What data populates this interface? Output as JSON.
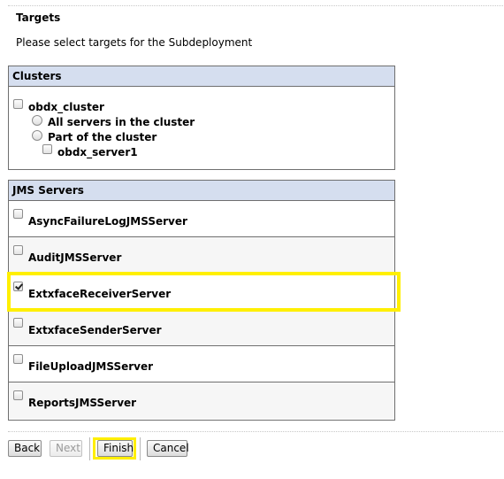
{
  "page": {
    "title": "Targets",
    "subtitle": "Please select targets for the Subdeployment"
  },
  "clusters": {
    "header": "Clusters",
    "cluster_name": "obdx_cluster",
    "all_servers_label": "All servers in the cluster",
    "part_label": "Part of the cluster",
    "server_name": "obdx_server1"
  },
  "jms": {
    "header": "JMS Servers",
    "servers": [
      {
        "name": "AsyncFailureLogJMSServer",
        "checked": false
      },
      {
        "name": "AuditJMSServer",
        "checked": false
      },
      {
        "name": "ExtxfaceReceiverServer",
        "checked": true
      },
      {
        "name": "ExtxfaceSenderServer",
        "checked": false
      },
      {
        "name": "FileUploadJMSServer",
        "checked": false
      },
      {
        "name": "ReportsJMSServer",
        "checked": false
      }
    ]
  },
  "buttons": {
    "back": "Back",
    "next": "Next",
    "finish": "Finish",
    "cancel": "Cancel"
  },
  "colors": {
    "header_bg": "#d5deef",
    "highlight": "#ffef00"
  }
}
